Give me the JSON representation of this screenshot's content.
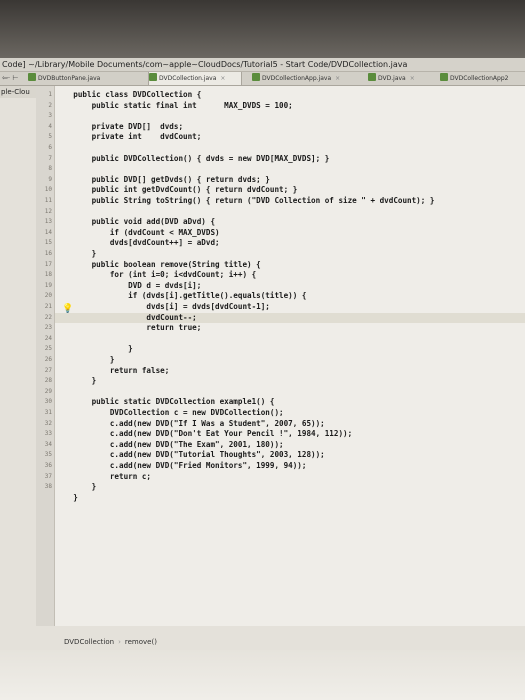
{
  "window": {
    "title": "Code] ~/Library/Mobile Documents/com~apple~CloudDocs/Tutorial5 - Start Code/DVDCollection.java"
  },
  "toolbar": {
    "nav_arrows": "⇦· ⊢"
  },
  "tabs": [
    {
      "label": "DVDButtonPane.java",
      "active": false
    },
    {
      "label": "DVDCollection.java",
      "active": true
    },
    {
      "label": "DVDCollectionApp.java",
      "active": false
    },
    {
      "label": "DVD.java",
      "active": false
    },
    {
      "label": "DVDCollectionApp2",
      "active": false
    }
  ],
  "project_panel": {
    "label": "ple-Clou"
  },
  "editor": {
    "highlighted_line": 22,
    "lines": [
      {
        "n": "1",
        "text": "    public class DVDCollection {"
      },
      {
        "n": "2",
        "text": "        public static final int      MAX_DVDS = 100;"
      },
      {
        "n": "3",
        "text": ""
      },
      {
        "n": "4",
        "text": "        private DVD[]  dvds;"
      },
      {
        "n": "5",
        "text": "        private int    dvdCount;"
      },
      {
        "n": "6",
        "text": ""
      },
      {
        "n": "7",
        "text": "        public DVDCollection() { dvds = new DVD[MAX_DVDS]; }"
      },
      {
        "n": "8",
        "text": ""
      },
      {
        "n": "9",
        "text": "        public DVD[] getDvds() { return dvds; }"
      },
      {
        "n": "10",
        "text": "        public int getDvdCount() { return dvdCount; }"
      },
      {
        "n": "11",
        "text": "        public String toString() { return (\"DVD Collection of size \" + dvdCount); }"
      },
      {
        "n": "12",
        "text": ""
      },
      {
        "n": "13",
        "text": "        public void add(DVD aDvd) {"
      },
      {
        "n": "14",
        "text": "            if (dvdCount < MAX_DVDS)"
      },
      {
        "n": "15",
        "text": "            dvds[dvdCount++] = aDvd;"
      },
      {
        "n": "16",
        "text": "        }"
      },
      {
        "n": "17",
        "text": "        public boolean remove(String title) {"
      },
      {
        "n": "18",
        "text": "            for (int i=0; i<dvdCount; i++) {"
      },
      {
        "n": "19",
        "text": "                DVD d = dvds[i];"
      },
      {
        "n": "20",
        "text": "                if (dvds[i].getTitle().equals(title)) {"
      },
      {
        "n": "21",
        "text": "                    dvds[i] = dvds[dvdCount-1];"
      },
      {
        "n": "22",
        "text": "                    dvdCount--;"
      },
      {
        "n": "23",
        "text": "                    return true;"
      },
      {
        "n": "24",
        "text": ""
      },
      {
        "n": "25",
        "text": "                }"
      },
      {
        "n": "26",
        "text": "            }"
      },
      {
        "n": "27",
        "text": "            return false;"
      },
      {
        "n": "28",
        "text": "        }"
      },
      {
        "n": "29",
        "text": ""
      },
      {
        "n": "30",
        "text": "        public static DVDCollection example1() {"
      },
      {
        "n": "31",
        "text": "            DVDCollection c = new DVDCollection();"
      },
      {
        "n": "32",
        "text": "            c.add(new DVD(\"If I Was a Student\", 2007, 65));"
      },
      {
        "n": "33",
        "text": "            c.add(new DVD(\"Don't Eat Your Pencil !\", 1984, 112));"
      },
      {
        "n": "34",
        "text": "            c.add(new DVD(\"The Exam\", 2001, 180));"
      },
      {
        "n": "35",
        "text": "            c.add(new DVD(\"Tutorial Thoughts\", 2003, 128));"
      },
      {
        "n": "36",
        "text": "            c.add(new DVD(\"Fried Monitors\", 1999, 94));"
      },
      {
        "n": "37",
        "text": "            return c;"
      },
      {
        "n": "38",
        "text": "        }"
      },
      {
        "n": "",
        "text": "    }"
      }
    ]
  },
  "breadcrumb": {
    "items": [
      "DVDCollection",
      "remove()"
    ],
    "separator": "›"
  },
  "colors": {
    "editor_bg": "#efede8",
    "gutter_bg": "#d9d6cf",
    "highlight_line": "#e0ddd2",
    "bulb": "#d8a21a"
  },
  "icons": {
    "intention": "lightbulb-icon",
    "file_tab": "java-file-icon"
  }
}
